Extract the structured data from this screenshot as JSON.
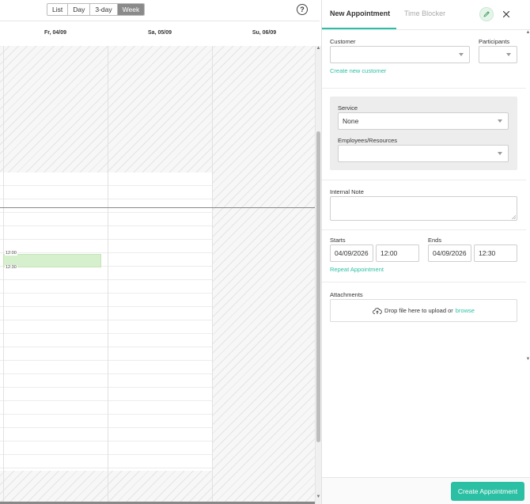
{
  "calendar": {
    "views": [
      "List",
      "Day",
      "3-day",
      "Week"
    ],
    "active_view": "Week",
    "help_label": "?",
    "days": [
      "Fr, 04/09",
      "Sa, 05/09",
      "Su, 06/09"
    ],
    "event": {
      "start": "12:00",
      "end": "12:30",
      "color": "#d6efcd"
    }
  },
  "panel": {
    "tabs": {
      "new_appointment": "New Appointment",
      "time_blocker": "Time Blocker"
    },
    "customer": {
      "label": "Customer",
      "value": "",
      "create_link": "Create new customer"
    },
    "participants": {
      "label": "Participants",
      "value": ""
    },
    "service": {
      "label": "Service",
      "value": "None"
    },
    "employees": {
      "label": "Employees/Resources",
      "value": ""
    },
    "note": {
      "label": "Internal Note",
      "value": ""
    },
    "starts": {
      "label": "Starts",
      "date": "04/09/2026",
      "time": "12:00"
    },
    "ends": {
      "label": "Ends",
      "date": "04/09/2026",
      "time": "12:30"
    },
    "repeat_link": "Repeat Appointment",
    "attachments": {
      "label": "Attachments",
      "drop_text": "Drop file here to upload or",
      "browse": "browse"
    },
    "create_button": "Create Appointment"
  },
  "colors": {
    "accent": "#2bbfa3",
    "active_view_bg": "#8a8a8a"
  }
}
